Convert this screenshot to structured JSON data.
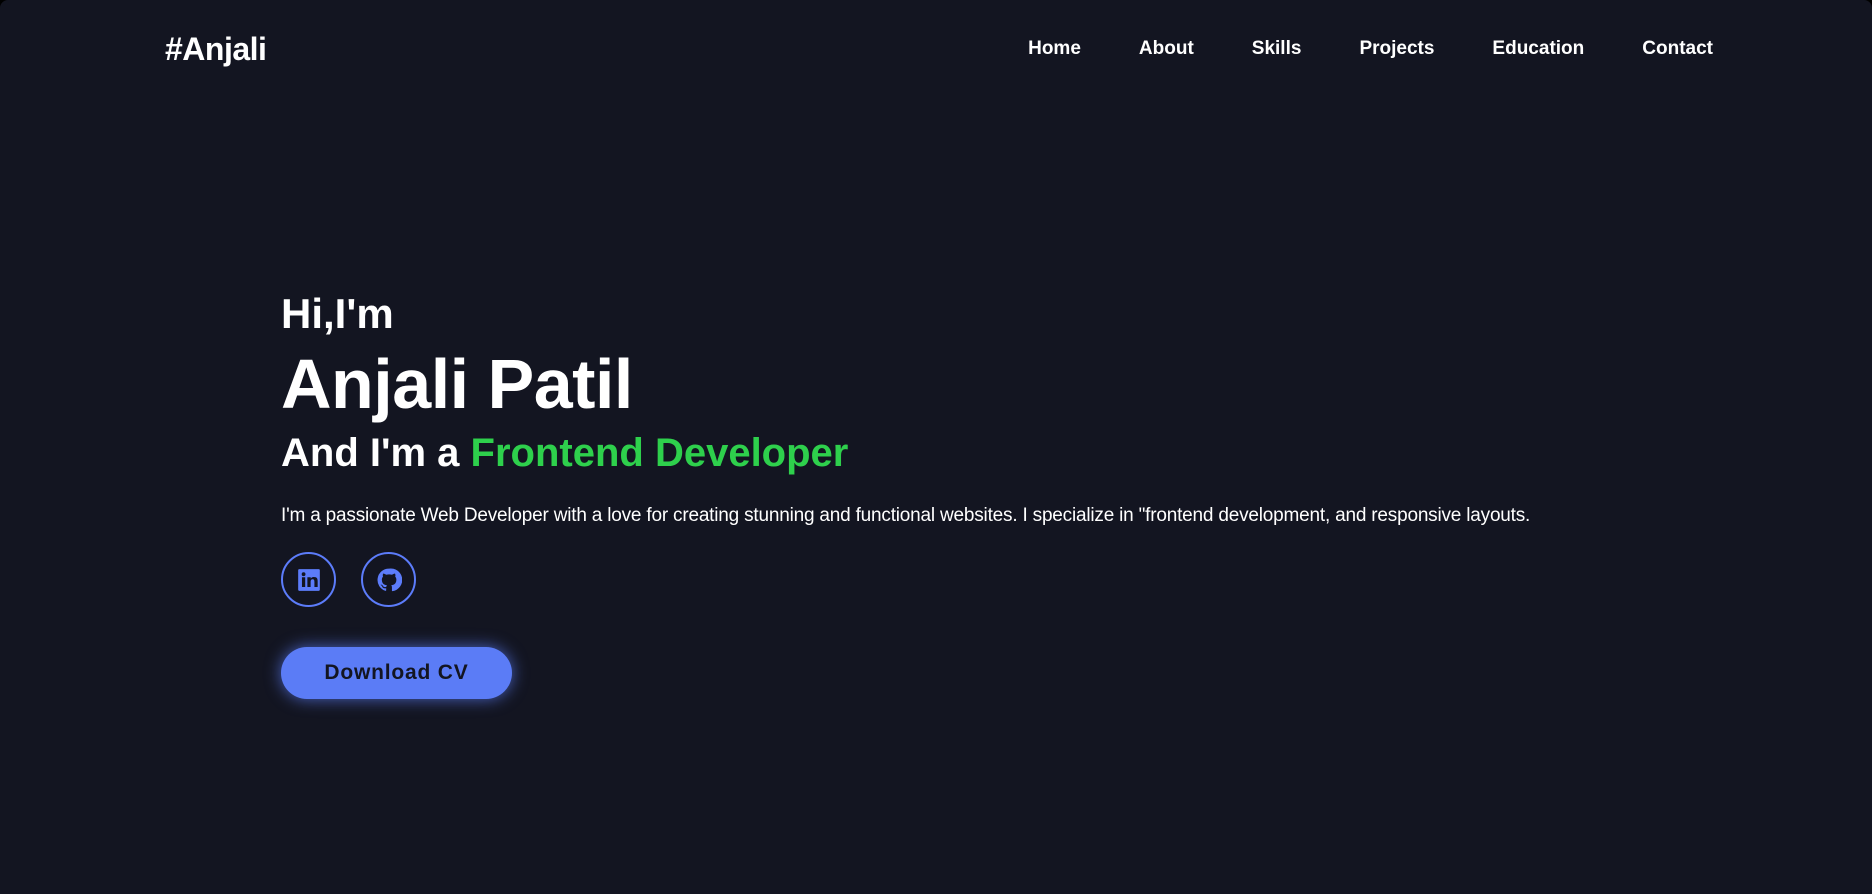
{
  "header": {
    "logo": "#Anjali",
    "nav": [
      {
        "label": "Home"
      },
      {
        "label": "About"
      },
      {
        "label": "Skills"
      },
      {
        "label": "Projects"
      },
      {
        "label": "Education"
      },
      {
        "label": "Contact"
      }
    ]
  },
  "hero": {
    "greeting": "Hi,I'm",
    "name": "Anjali Patil",
    "role_prefix": "And I'm a ",
    "role_highlight": "Frontend Developer",
    "bio": "I'm a passionate Web Developer with a love for creating stunning and functional websites. I specialize in \"frontend development, and responsive layouts.",
    "socials": [
      {
        "icon": "linkedin-icon"
      },
      {
        "icon": "github-icon"
      }
    ],
    "cv_button": "Download CV"
  },
  "colors": {
    "background": "#131521",
    "accent_blue": "#5b7cf6",
    "accent_green": "#2ed04c",
    "text": "#ffffff"
  }
}
